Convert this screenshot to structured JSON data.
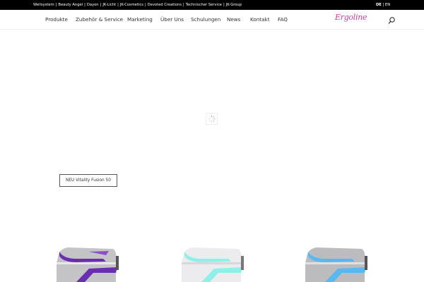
{
  "topbar": {
    "brands": [
      "Wellsystem",
      "Beauty Angel",
      "Dayon",
      "JK-Licht",
      "JK-Cosmetics",
      "Devoted Creations",
      "Technischer Service",
      "JK-Group"
    ],
    "separator": "|",
    "lang_active": "DE",
    "lang_sep": "|",
    "lang_other": "EN"
  },
  "nav": {
    "items": [
      "Produkte",
      "Zubehör & Service",
      "Marketing",
      "Über Uns",
      "Schulungen",
      "News",
      "Kontakt",
      "FAQ"
    ],
    "logo": "Ergoline"
  },
  "hero": {
    "button_label": "NEU Vitality Fusion 50"
  },
  "products": [
    {
      "name": "purple-solarium",
      "accent": "#6a2fb0"
    },
    {
      "name": "turquoise-solarium",
      "accent": "#7fe8e0"
    },
    {
      "name": "blue-solarium",
      "accent": "#5ab8f0"
    }
  ]
}
